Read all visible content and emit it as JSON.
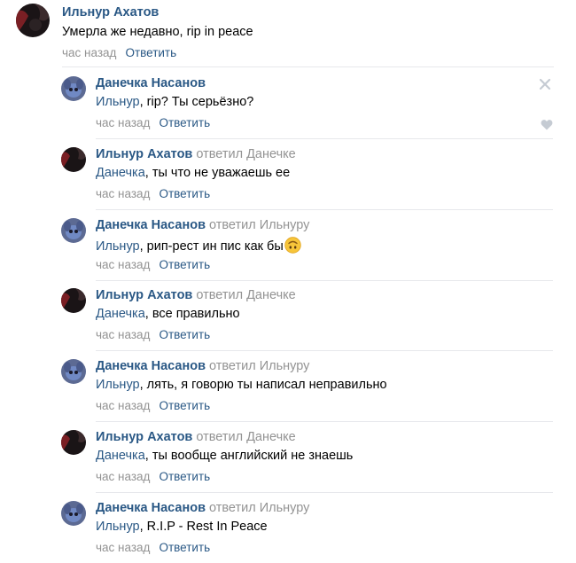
{
  "top_comment": {
    "author": "Ильнур Ахатов",
    "text": "Умерла же недавно, rip in peace",
    "time": "час назад",
    "reply_label": "Ответить"
  },
  "replies": [
    {
      "author": "Данечка Насанов",
      "answered": "",
      "mention": "Ильнур",
      "text": ", rip? Ты серьёзно?",
      "time": "час назад",
      "reply_label": "Ответить",
      "avatar": "stitch"
    },
    {
      "author": "Ильнур Ахатов",
      "answered": "ответил Данечке",
      "mention": "Данечка",
      "text": ", ты что не уважаешь ее",
      "time": "час назад",
      "reply_label": "Ответить",
      "avatar": "dark"
    },
    {
      "author": "Данечка Насанов",
      "answered": "ответил Ильнуру",
      "mention": "Ильнур",
      "text": ", рип-рест ин пис как бы",
      "time": "час назад",
      "reply_label": "Ответить",
      "avatar": "stitch",
      "emoji": "upside-down-face"
    },
    {
      "author": "Ильнур Ахатов",
      "answered": "ответил Данечке",
      "mention": "Данечка",
      "text": ", все правильно",
      "time": "час назад",
      "reply_label": "Ответить",
      "avatar": "dark"
    },
    {
      "author": "Данечка Насанов",
      "answered": "ответил Ильнуру",
      "mention": "Ильнур",
      "text": ", лять, я говорю ты написал неправильно",
      "time": "час назад",
      "reply_label": "Ответить",
      "avatar": "stitch"
    },
    {
      "author": "Ильнур Ахатов",
      "answered": "ответил Данечке",
      "mention": "Данечка",
      "text": ", ты вообще английский не знаешь",
      "time": "час назад",
      "reply_label": "Ответить",
      "avatar": "dark"
    },
    {
      "author": "Данечка Насанов",
      "answered": "ответил Ильнуру",
      "mention": "Ильнур",
      "text": ", R.I.P - Rest In Peace",
      "time": "час назад",
      "reply_label": "Ответить",
      "avatar": "stitch"
    }
  ],
  "icons": {
    "close": "close-icon",
    "like": "heart-icon"
  },
  "colors": {
    "link": "#2a5885",
    "meta": "#939393",
    "divider": "#e7e8ec",
    "icon": "#c5cbd3"
  }
}
